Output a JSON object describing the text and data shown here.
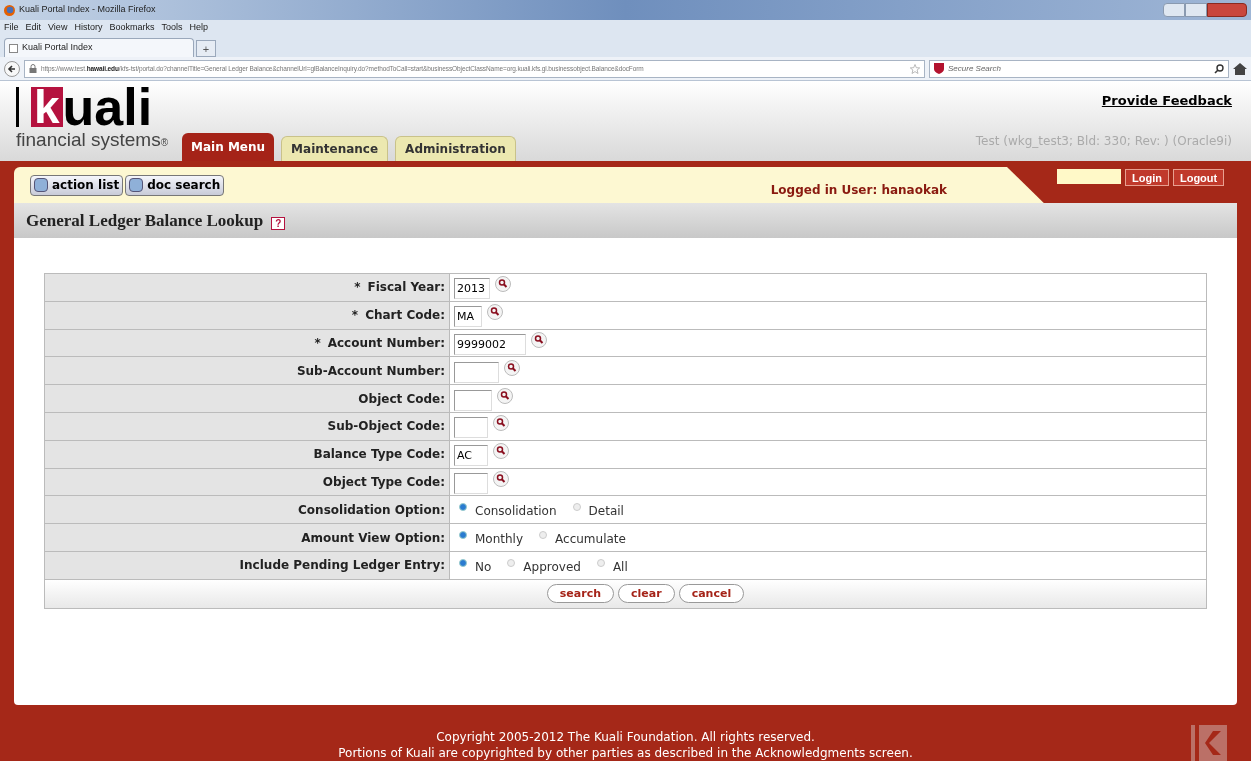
{
  "browser": {
    "title": "Kuali Portal Index - Mozilla Firefox",
    "menu": [
      "File",
      "Edit",
      "View",
      "History",
      "Bookmarks",
      "Tools",
      "Help"
    ],
    "tab": "Kuali Portal Index",
    "new_tab": "+",
    "url_host": "https://www.test.",
    "url_domain": "hawaii.edu",
    "url_path": "/kfs-tst/portal.do?channelTitle=General Ledger Balance&channelUrl=glBalanceInquiry.do?methodToCall=start&businessObjectClassName=org.kuali.kfs.gl.businessobject.Balance&docForm",
    "search_placeholder": "Secure Search"
  },
  "header": {
    "logo": "kuali",
    "tagline": "financial systems",
    "registered": "®",
    "feedback": "Provide Feedback",
    "build_info": "Test (wkg_test3; Bld: 330; Rev: ) (Oracle9i)"
  },
  "nav_tabs": [
    {
      "label": "Main Menu",
      "selected": true
    },
    {
      "label": "Maintenance",
      "selected": false
    },
    {
      "label": "Administration",
      "selected": false
    }
  ],
  "toolbar": [
    "action list",
    "doc search"
  ],
  "logged_in": "Logged in User: hanaokak",
  "login_buttons": [
    "Login",
    "Logout"
  ],
  "page_title": "General Ledger Balance Lookup",
  "help": "?",
  "fields": [
    {
      "kind": "text",
      "marker": "*",
      "label": "Fiscal Year:",
      "value": "2013"
    },
    {
      "kind": "text",
      "marker": "*",
      "label": "Chart Code:",
      "value": "MA"
    },
    {
      "kind": "text",
      "marker": "*",
      "label": "Account Number:",
      "value": "9999002"
    },
    {
      "kind": "text",
      "label": "Sub-Account Number:"
    },
    {
      "kind": "text",
      "label": "Object Code:"
    },
    {
      "kind": "text",
      "label": "Sub-Object Code:"
    },
    {
      "kind": "text",
      "label": "Balance Type Code:",
      "value": "AC"
    },
    {
      "kind": "text",
      "label": "Object Type Code:"
    },
    {
      "kind": "radio",
      "label": "Consolidation Option:",
      "options": [
        {
          "label": "Consolidation",
          "selected": true
        },
        {
          "label": "Detail",
          "selected": false
        }
      ]
    },
    {
      "kind": "radio",
      "label": "Amount View Option:",
      "options": [
        {
          "label": "Monthly",
          "selected": true
        },
        {
          "label": "Accumulate",
          "selected": false
        }
      ]
    },
    {
      "kind": "radio",
      "label": "Include Pending Ledger Entry:",
      "options": [
        {
          "label": "No",
          "selected": true
        },
        {
          "label": "Approved",
          "selected": false
        },
        {
          "label": "All",
          "selected": false
        }
      ]
    }
  ],
  "actions": [
    "search",
    "clear",
    "cancel"
  ],
  "footer": [
    "Copyright 2005-2012 The Kuali Foundation. All rights reserved.",
    "Portions of Kuali are copyrighted by other parties as described in the Acknowledgments screen."
  ]
}
